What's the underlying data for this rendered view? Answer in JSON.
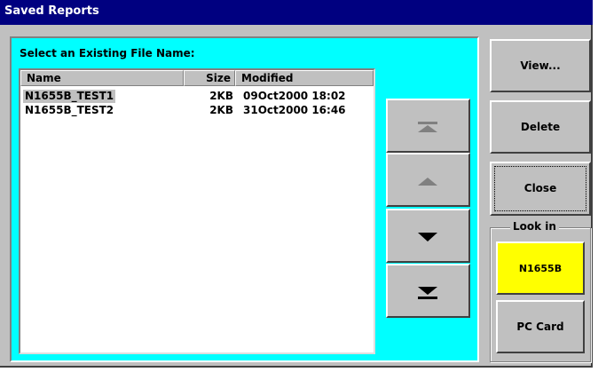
{
  "window": {
    "title": "Saved Reports"
  },
  "panel": {
    "label": "Select an Existing File Name:"
  },
  "file_list": {
    "columns": [
      "Name",
      "Size",
      "Modified"
    ],
    "rows": [
      {
        "name": "N1655B_TEST1",
        "size": "2KB",
        "modified": "09Oct2000 18:02",
        "selected": true
      },
      {
        "name": "N1655B_TEST2",
        "size": "2KB",
        "modified": "31Oct2000 16:46",
        "selected": false
      }
    ]
  },
  "scroll_buttons": [
    {
      "icon": "scroll-to-top-icon",
      "enabled": false
    },
    {
      "icon": "scroll-up-icon",
      "enabled": false
    },
    {
      "icon": "scroll-down-icon",
      "enabled": true
    },
    {
      "icon": "scroll-to-bottom-icon",
      "enabled": true
    }
  ],
  "buttons": {
    "view": "View...",
    "delete": "Delete",
    "close": "Close"
  },
  "look_in": {
    "label": "Look in",
    "options": [
      "N1655B",
      "PC Card"
    ],
    "selected": "N1655B"
  },
  "colors": {
    "title_bar": "#000080",
    "panel_bg": "#00ffff",
    "selected_location": "#ffff00",
    "disabled_arrow": "#808080"
  }
}
